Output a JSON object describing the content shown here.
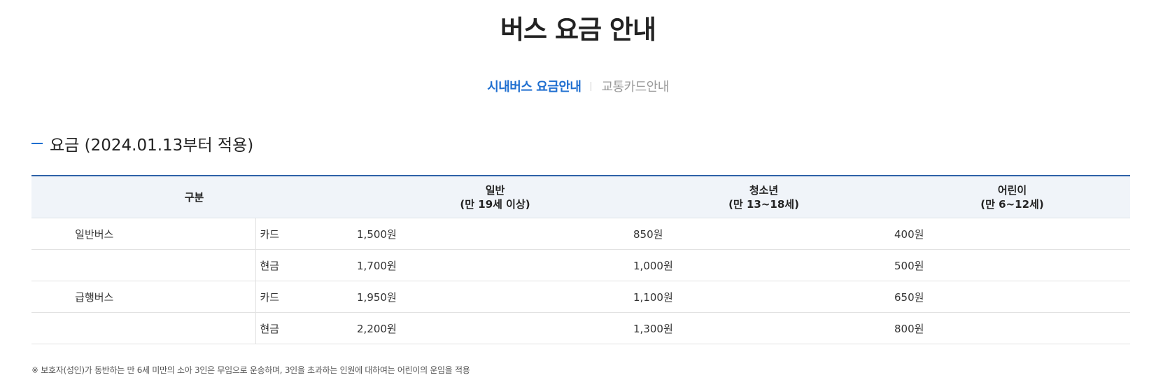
{
  "page": {
    "title": "버스 요금 안내"
  },
  "tabs": [
    {
      "label": "시내버스 요금안내",
      "active": true
    },
    {
      "label": "교통카드안내",
      "active": false
    }
  ],
  "section": {
    "title": "요금 (2024.01.13부터 적용)"
  },
  "table": {
    "headers": {
      "category": "구분",
      "adult": {
        "label": "일반",
        "sub": "(만 19세 이상)"
      },
      "youth": {
        "label": "청소년",
        "sub": "(만 13~18세)"
      },
      "child": {
        "label": "어린이",
        "sub": "(만 6~12세)"
      }
    },
    "rows": [
      {
        "bus_type": "일반버스",
        "payment": "카드",
        "adult": "1,500원",
        "youth": "850원",
        "child": "400원"
      },
      {
        "bus_type": "",
        "payment": "현금",
        "adult": "1,700원",
        "youth": "1,000원",
        "child": "500원"
      },
      {
        "bus_type": "급행버스",
        "payment": "카드",
        "adult": "1,950원",
        "youth": "1,100원",
        "child": "650원"
      },
      {
        "bus_type": "",
        "payment": "현금",
        "adult": "2,200원",
        "youth": "1,300원",
        "child": "800원"
      }
    ]
  },
  "note": "※ 보호자(성인)가 동반하는 만 6세 미만의 소아 3인은 무임으로 운송하며, 3인을 초과하는 인원에 대하여는 어린이의 운임을 적용",
  "colors": {
    "accent": "#1f6fd0",
    "table_border": "#2e62a8",
    "header_bg": "#f0f4f9"
  }
}
